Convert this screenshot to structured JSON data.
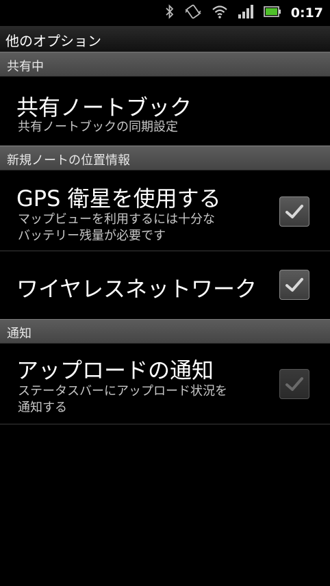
{
  "status_bar": {
    "time": "0:17",
    "icons": [
      "bluetooth-icon",
      "vibrate-icon",
      "wifi-icon",
      "signal-icon",
      "battery-icon"
    ]
  },
  "title": "他のオプション",
  "sections": {
    "sharing": {
      "header": "共有中",
      "notebook_title": "共有ノートブック",
      "notebook_summary": "共有ノートブックの同期設定"
    },
    "location": {
      "header": "新規ノートの位置情報",
      "gps_title": "GPS 衛星を使用する",
      "gps_summary": "マップビューを利用するには十分な\nバッテリー残量が必要です",
      "gps_checked": true,
      "wireless_title": "ワイヤレスネットワーク",
      "wireless_checked": true
    },
    "notify": {
      "header": "通知",
      "upload_title": "アップロードの通知",
      "upload_summary": "ステータスバーにアップロード状況を\n通知する",
      "upload_checked": true,
      "upload_enabled": false
    }
  },
  "colors": {
    "background": "#000000",
    "section_header": "#4f4f4f",
    "summary_text": "#c8c8c8"
  }
}
